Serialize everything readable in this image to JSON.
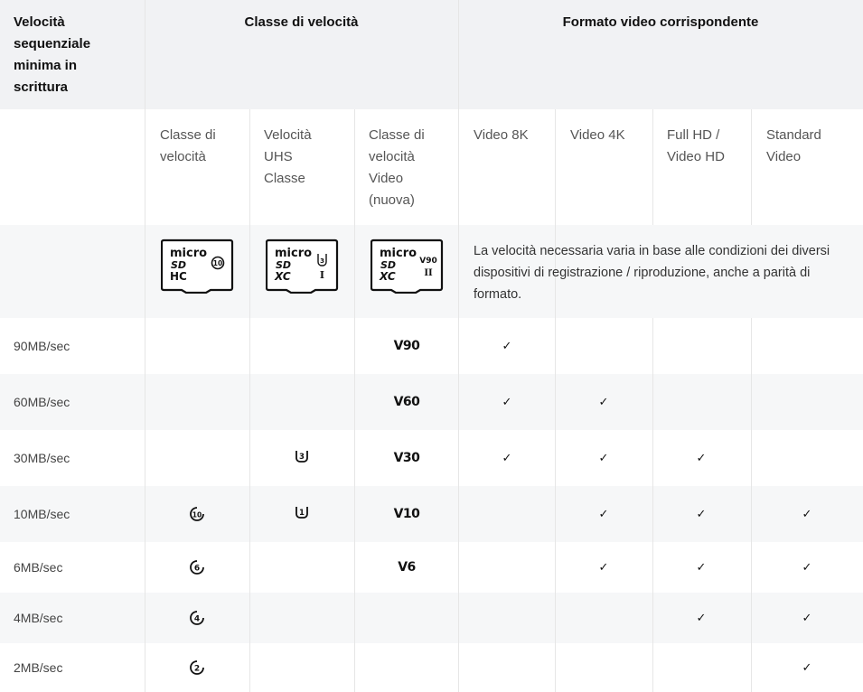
{
  "header": {
    "col_min_speed": "Velocità sequenziale minima in scrittura",
    "group_speed_class": "Classe di velocità",
    "group_video_format": "Formato video corrispondente"
  },
  "subheader": {
    "speed_class": "Classe di velocità",
    "uhs_speed_class": "Velocità UHS Classe",
    "video_speed_class": "Classe di velocità Video (nuova)",
    "video_8k": "Video 8K",
    "video_4k": "Video 4K",
    "full_hd": "Full HD / Video HD",
    "standard_video": "Standard Video"
  },
  "cards": {
    "sdhc": {
      "micro": "micro",
      "sd": "SD",
      "type": "HC",
      "class": "10"
    },
    "sdxc_uhs": {
      "micro": "micro",
      "sd": "SD",
      "type": "XC",
      "class": "3",
      "bus": "I"
    },
    "sdxc_video": {
      "micro": "micro",
      "sd": "SD",
      "type": "XC",
      "class": "V90",
      "bus": "II"
    }
  },
  "note": "La velocità necessaria varia in base alle condizioni dei diversi dispositivi di registrazione / riproduzione, anche a parità di formato.",
  "check_symbol": "✓",
  "rows": [
    {
      "speed": "90MB/sec",
      "speed_class": "",
      "uhs": "",
      "video": "V90",
      "v8k": true,
      "v4k": false,
      "fhd": false,
      "std": false
    },
    {
      "speed": "60MB/sec",
      "speed_class": "",
      "uhs": "",
      "video": "V60",
      "v8k": true,
      "v4k": true,
      "fhd": false,
      "std": false
    },
    {
      "speed": "30MB/sec",
      "speed_class": "",
      "uhs": "3",
      "video": "V30",
      "v8k": true,
      "v4k": true,
      "fhd": true,
      "std": false
    },
    {
      "speed": "10MB/sec",
      "speed_class": "10",
      "uhs": "1",
      "video": "V10",
      "v8k": false,
      "v4k": true,
      "fhd": true,
      "std": true
    },
    {
      "speed": "6MB/sec",
      "speed_class": "6",
      "uhs": "",
      "video": "V6",
      "v8k": false,
      "v4k": true,
      "fhd": true,
      "std": true
    },
    {
      "speed": "4MB/sec",
      "speed_class": "4",
      "uhs": "",
      "video": "",
      "v8k": false,
      "v4k": false,
      "fhd": true,
      "std": true
    },
    {
      "speed": "2MB/sec",
      "speed_class": "2",
      "uhs": "",
      "video": "",
      "v8k": false,
      "v4k": false,
      "fhd": false,
      "std": true
    }
  ],
  "colors": {
    "header_bg": "#f1f2f4",
    "stripe_bg": "#f6f7f8",
    "border": "#e6e6e6"
  }
}
